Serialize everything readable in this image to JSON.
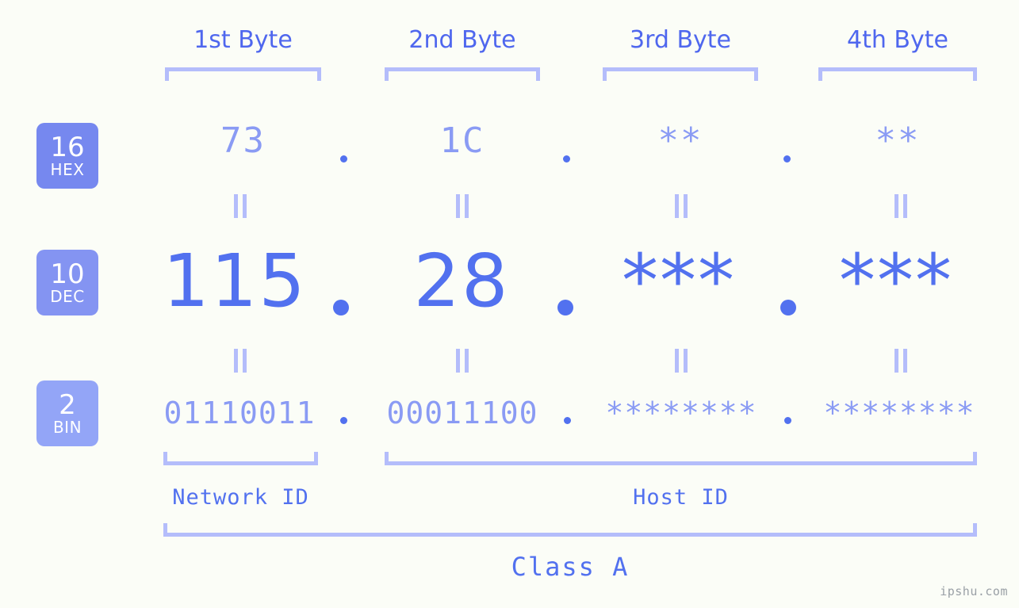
{
  "page": {
    "background_color": "#fbfdf7",
    "accent_color": "#5271ef",
    "accent_light_color": "#8a9bf4",
    "bracket_color": "#b4bdfb",
    "watermark": "ipshu.com"
  },
  "header": {
    "byte_labels": [
      {
        "label": "1st Byte"
      },
      {
        "label": "2nd Byte"
      },
      {
        "label": "3rd Byte"
      },
      {
        "label": "4th Byte"
      }
    ]
  },
  "bases": [
    {
      "number": "16",
      "name": "HEX",
      "color": "#7688ef"
    },
    {
      "number": "10",
      "name": "DEC",
      "color": "#8494f2"
    },
    {
      "number": "2",
      "name": "BIN",
      "color": "#93a5f7"
    }
  ],
  "rows": {
    "hex": {
      "base_number": "16",
      "base_name": "HEX",
      "values": [
        "73",
        "1C",
        "**",
        "**"
      ],
      "separator": "."
    },
    "dec": {
      "base_number": "10",
      "base_name": "DEC",
      "values": [
        "115",
        "28",
        "***",
        "***"
      ],
      "separator": "."
    },
    "bin": {
      "base_number": "2",
      "base_name": "BIN",
      "values": [
        "01110011",
        "00011100",
        "********",
        "********"
      ],
      "separator": "."
    }
  },
  "equals_marks": {
    "symbol": "=",
    "count_per_gap": 4,
    "gaps": 2
  },
  "footer": {
    "network_id_label": "Network ID",
    "host_id_label": "Host ID",
    "class_label": "Class A"
  }
}
